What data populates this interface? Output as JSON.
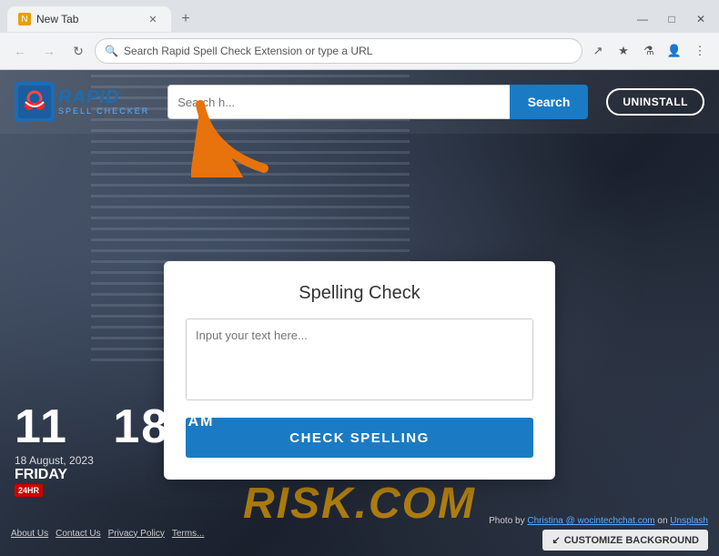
{
  "browser": {
    "tab_title": "New Tab",
    "address_text": "Search Rapid Spell Check Extension or type a URL",
    "new_tab_icon": "+",
    "back_disabled": true,
    "forward_disabled": true
  },
  "header": {
    "logo_rapid": "RAPID",
    "logo_sub": "SPELL CHECKER",
    "search_placeholder": "Search h...",
    "search_button": "Search",
    "uninstall_button": "UNINSTALL"
  },
  "card": {
    "title": "Spelling Check",
    "textarea_placeholder": "Input your text here...",
    "check_button": "CHECK SPELLING"
  },
  "time": {
    "hours": "11",
    "minutes": "18",
    "ampm": "AM",
    "date": "18 August, 2023",
    "day": "FRIDAY"
  },
  "bottom": {
    "timer": "24HR",
    "links": [
      "About Us",
      "Contact Us",
      "Privacy Policy",
      "Terms..."
    ],
    "photo_credit_prefix": "Photo by ",
    "photo_credit_author": "Christina @ wocintechchat.com",
    "photo_credit_suffix": " on ",
    "photo_credit_platform": "Unsplash",
    "customize_icon": "↙",
    "customize_button": "CUSTOMIZE BACKGROUND"
  },
  "watermark": "RISK.COM"
}
